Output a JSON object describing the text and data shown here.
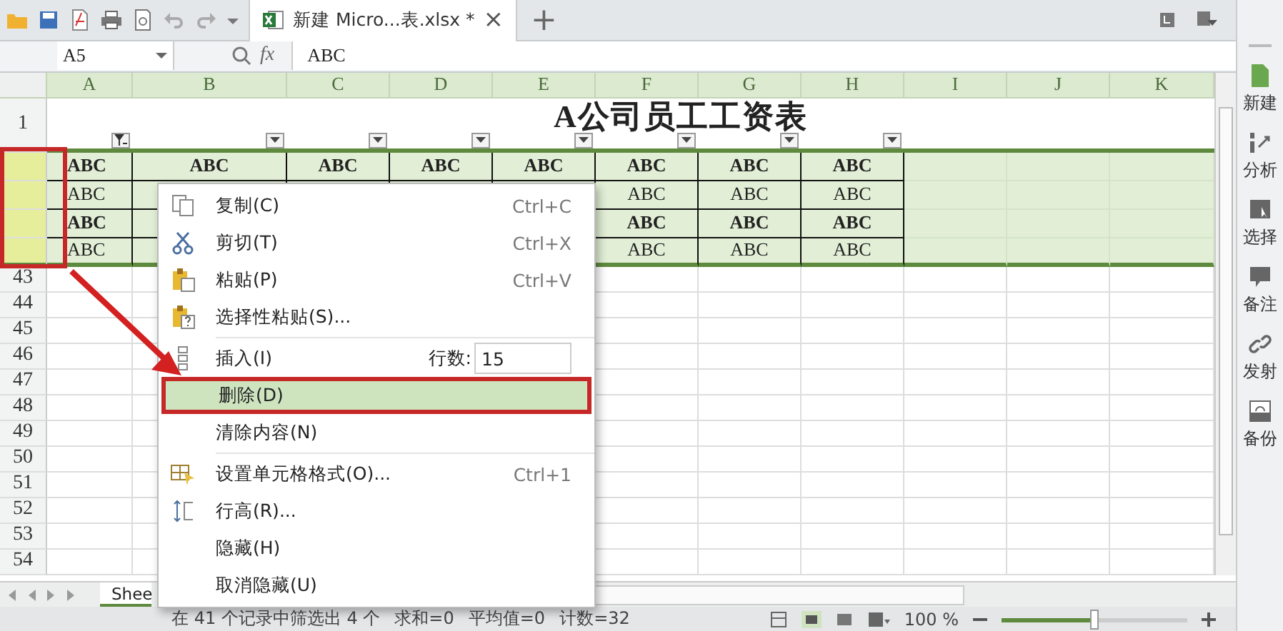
{
  "toolbar": {
    "tab": {
      "title": "新建 Micro...表.xlsx *",
      "close": "×"
    },
    "new_tab": "+"
  },
  "formula_bar": {
    "name_box": "A5",
    "fx": "fx",
    "value": "ABC"
  },
  "sheet": {
    "columns": [
      "A",
      "B",
      "C",
      "D",
      "E",
      "F",
      "G",
      "H",
      "I",
      "J",
      "K"
    ],
    "title_row": "1",
    "title": "A公司员工工资表",
    "filters": [
      {
        "active": true
      },
      {
        "active": false
      },
      {
        "active": false
      },
      {
        "active": false
      },
      {
        "active": false
      },
      {
        "active": false
      },
      {
        "active": false
      },
      {
        "active": false
      }
    ],
    "data_rows": [
      {
        "selected": true,
        "bold": true,
        "cells": [
          "ABC",
          "ABC",
          "ABC",
          "ABC",
          "ABC",
          "ABC",
          "ABC",
          "ABC"
        ]
      },
      {
        "selected": true,
        "bold": false,
        "cells": [
          "ABC",
          null,
          null,
          null,
          null,
          "ABC",
          "ABC",
          "ABC"
        ]
      },
      {
        "selected": true,
        "bold": true,
        "cells": [
          "ABC",
          null,
          null,
          null,
          null,
          "ABC",
          "ABC",
          "ABC"
        ]
      },
      {
        "selected": true,
        "bold": false,
        "cells": [
          "ABC",
          null,
          null,
          null,
          null,
          "ABC",
          "ABC",
          "ABC"
        ]
      }
    ],
    "row_numbers": [
      "43",
      "44",
      "45",
      "46",
      "47",
      "48",
      "49",
      "50",
      "51",
      "52",
      "53",
      "54"
    ]
  },
  "context_menu": {
    "items": [
      {
        "kind": "item",
        "label": "复制(C)",
        "shortcut": "Ctrl+C",
        "selected": false
      },
      {
        "kind": "item",
        "label": "剪切(T)",
        "shortcut": "Ctrl+X",
        "selected": false
      },
      {
        "kind": "item",
        "label": "粘贴(P)",
        "shortcut": "Ctrl+V",
        "selected": false
      },
      {
        "kind": "item",
        "label": "选择性粘贴(S)...",
        "selected": false
      },
      {
        "kind": "separator"
      },
      {
        "kind": "input",
        "label": "插入(I)",
        "field_label": "行数:",
        "value": "15",
        "selected": false
      },
      {
        "kind": "item",
        "label": "删除(D)",
        "selected": true
      },
      {
        "kind": "item",
        "label": "清除内容(N)",
        "selected": false
      },
      {
        "kind": "separator"
      },
      {
        "kind": "item",
        "label": "设置单元格格式(O)...",
        "shortcut": "Ctrl+1",
        "selected": false
      },
      {
        "kind": "item",
        "label": "行高(R)...",
        "selected": false
      },
      {
        "kind": "item",
        "label": "隐藏(H)",
        "selected": false
      },
      {
        "kind": "item",
        "label": "取消隐藏(U)",
        "selected": false
      }
    ]
  },
  "side_panel": {
    "items": [
      {
        "label": "新建"
      },
      {
        "label": "分析"
      },
      {
        "label": "选择"
      },
      {
        "label": "备注"
      },
      {
        "label": "发射"
      },
      {
        "label": "备份"
      }
    ]
  },
  "sheet_tabs": [
    {
      "label": "Shee",
      "selected": true
    }
  ],
  "status_bar": {
    "filter_info": "在 41 个记录中筛选出 4 个",
    "sum": "求和=0",
    "average": "平均值=0",
    "count": "计数=32",
    "zoom": "100 %",
    "zoom_slider": {
      "level": 0.5
    }
  }
}
